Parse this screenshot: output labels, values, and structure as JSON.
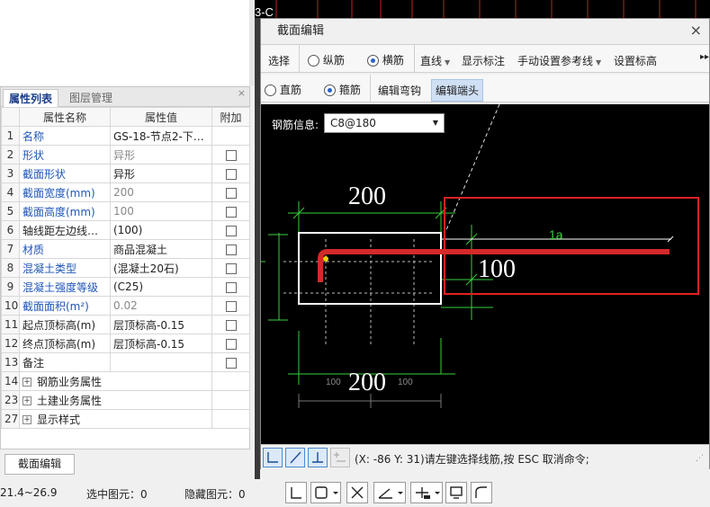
{
  "cad_top_label": "3-C",
  "left_panel": {
    "tabs": [
      {
        "label": "属性列表"
      },
      {
        "label": "图层管理"
      }
    ],
    "close": "×",
    "headers": {
      "name": "属性名称",
      "value": "属性值",
      "extra": "附加"
    },
    "rows": [
      {
        "num": "1",
        "name": "名称",
        "value": "GS-18-节点2-下…",
        "name_style": "blue",
        "value_style": "",
        "checkbox": false
      },
      {
        "num": "2",
        "name": "形状",
        "value": "异形",
        "name_style": "blue",
        "value_style": "gray",
        "checkbox": true
      },
      {
        "num": "3",
        "name": "截面形状",
        "value": "异形",
        "name_style": "blue",
        "value_style": "",
        "checkbox": true
      },
      {
        "num": "4",
        "name": "截面宽度(mm)",
        "value": "200",
        "name_style": "blue",
        "value_style": "gray",
        "checkbox": true
      },
      {
        "num": "5",
        "name": "截面高度(mm)",
        "value": "100",
        "name_style": "blue",
        "value_style": "gray",
        "checkbox": true
      },
      {
        "num": "6",
        "name": "轴线距左边线…",
        "value": "(100)",
        "name_style": "",
        "value_style": "",
        "checkbox": true
      },
      {
        "num": "7",
        "name": "材质",
        "value": "商品混凝土",
        "name_style": "blue",
        "value_style": "",
        "checkbox": true
      },
      {
        "num": "8",
        "name": "混凝土类型",
        "value": "(混凝土20石)",
        "name_style": "blue",
        "value_style": "",
        "checkbox": true
      },
      {
        "num": "9",
        "name": "混凝土强度等级",
        "value": "(C25)",
        "name_style": "blue",
        "value_style": "",
        "checkbox": true
      },
      {
        "num": "10",
        "name": "截面面积(m²)",
        "value": "0.02",
        "name_style": "blue",
        "value_style": "gray",
        "checkbox": true
      },
      {
        "num": "11",
        "name": "起点顶标高(m)",
        "value": "层顶标高-0.15",
        "name_style": "",
        "value_style": "",
        "checkbox": true
      },
      {
        "num": "12",
        "name": "终点顶标高(m)",
        "value": "层顶标高-0.15",
        "name_style": "",
        "value_style": "",
        "checkbox": true
      },
      {
        "num": "13",
        "name": "备注",
        "value": "",
        "name_style": "",
        "value_style": "",
        "checkbox": true
      }
    ],
    "groups": [
      {
        "num": "14",
        "label": "钢筋业务属性"
      },
      {
        "num": "23",
        "label": "土建业务属性"
      },
      {
        "num": "27",
        "label": "显示样式"
      }
    ],
    "edit_button": "截面编辑"
  },
  "status": {
    "range": "21.4~26.9",
    "selected": "选中图元：0",
    "hidden": "隐藏图元：0"
  },
  "dialog": {
    "title": "截面编辑",
    "close": "×",
    "toolbar1": {
      "select": "选择",
      "longitudinal": "纵筋",
      "transverse": "横筋",
      "line": "直线",
      "show_label": "显示标注",
      "manual_ref": "手动设置参考线",
      "set_elev": "设置标高",
      "more": "▸▸"
    },
    "toolbar2": {
      "straight": "直筋",
      "stirrup": "箍筋",
      "edit_hook": "编辑弯钩",
      "edit_end": "编辑端头"
    },
    "rebar_info_label": "钢筋信息:",
    "rebar_value": "C8@180",
    "drawing": {
      "dim_top": "200",
      "dim_right": "100",
      "dim_bottom": "200",
      "dim_sub_left": "100",
      "dim_sub_right": "100",
      "la_label": "1a"
    },
    "command_text": "(X: -86 Y: 31)请左键选择线筋,按 ESC 取消命令;"
  },
  "colors": {
    "rebar": "#d42a2a",
    "dim": "#39d03a",
    "highlight": "#e02020"
  }
}
